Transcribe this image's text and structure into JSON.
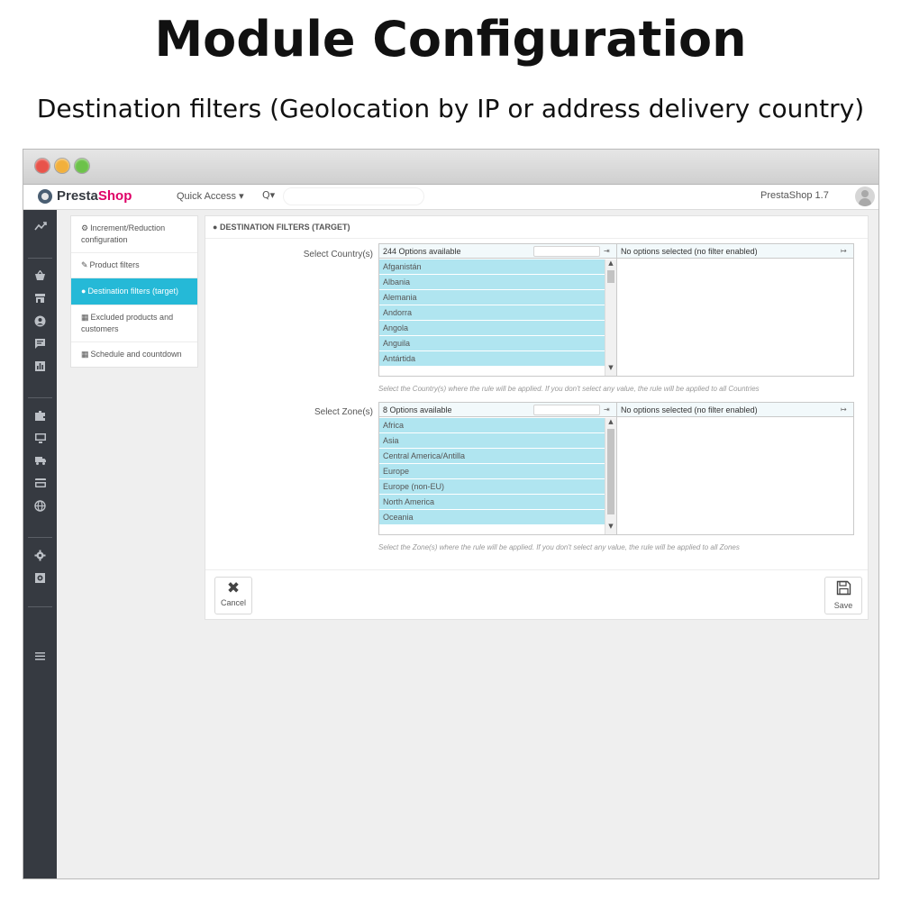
{
  "hero": {
    "title": "Module Configuration",
    "subtitle": "Destination filters (Geolocation by IP or address delivery country)"
  },
  "topbar": {
    "logo_presta": "Presta",
    "logo_shop": "Shop",
    "quick_access": "Quick Access ▾",
    "search_icon": "Q▾",
    "version": "PrestaShop 1.7"
  },
  "sidebar": {
    "icons": [
      "trending-icon",
      "basket-icon",
      "store-icon",
      "customer-icon",
      "messages-icon",
      "stats-icon",
      "modules-icon",
      "design-icon",
      "shipping-icon",
      "payment-icon",
      "international-icon",
      "settings-icon",
      "advanced-icon",
      "menu-icon"
    ]
  },
  "menu": {
    "items": [
      {
        "icon": "⚙",
        "label": "Increment/Reduction configuration"
      },
      {
        "icon": "✎",
        "label": "Product filters"
      },
      {
        "icon": "●",
        "label": "Destination filters (target)"
      },
      {
        "icon": "▦",
        "label": "Excluded products and customers"
      },
      {
        "icon": "▦",
        "label": "Schedule and countdown"
      }
    ]
  },
  "panel": {
    "heading_icon": "●",
    "heading": "DESTINATION FILTERS (TARGET)",
    "country": {
      "label": "Select Country(s)",
      "available": "244 Options available",
      "selected": "No options selected (no filter enabled)",
      "options": [
        "Afganistán",
        "Albania",
        "Alemania",
        "Andorra",
        "Angola",
        "Anguila",
        "Antártida"
      ],
      "help": "Select the Country(s) where the rule will be applied. If you don't select any value, the rule will be applied to all Countries"
    },
    "zone": {
      "label": "Select Zone(s)",
      "available": "8 Options available",
      "selected": "No options selected (no filter enabled)",
      "options": [
        "Africa",
        "Asia",
        "Central America/Antilla",
        "Europe",
        "Europe (non-EU)",
        "North America",
        "Oceania"
      ],
      "help": "Select the Zone(s) where the rule will be applied. If you don't select any value, the rule will be applied to all Zones"
    },
    "cancel_icon": "✖",
    "cancel_label": "Cancel",
    "save_icon": "🖫",
    "save_label": "Save"
  },
  "colors": {
    "accent": "#25b9d7",
    "option_bg": "#b0e5f0",
    "sidebar_bg": "#363a41",
    "brand_pink": "#df0067"
  }
}
